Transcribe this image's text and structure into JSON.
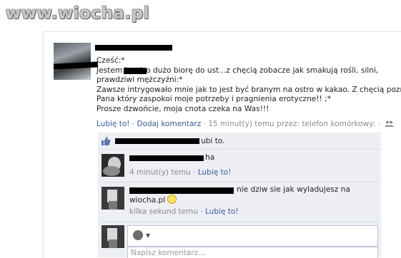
{
  "watermark": {
    "text": "www.wiocha.pl"
  },
  "post": {
    "lines": [
      "Cześć:*",
      "Jestem        bardzo dużo biorę do ust...z chęcią zobacze jak smakują rośli, silni,",
      "prawdziwi mężczyźni:*",
      "Zawsze intrygowało mnie jak to jest być branym na ostro w kakao. Z chęcią poznam",
      "Pana który zaspokoi moje potrzeby i pragnienia erotyczne!! ;*",
      "Prosze dzwońcie, moja cnota czeka na Was!!!"
    ],
    "like_link": "Lubię to!",
    "comment_link": "Dodaj komentarz",
    "timestamp": "15 minut(y) temu przez: telefon komórkowy:",
    "separator": "·"
  },
  "likes": {
    "text": "ubi to."
  },
  "comments": [
    {
      "text": "ha",
      "time": "4 minut(y) temu",
      "like_link": "Lubię to!"
    },
    {
      "text_line1": "nie dziw sie jak wyladujesz na",
      "text_line2": "wiocha.pl",
      "time": "kilka sekund temu",
      "like_link": "Lubię to!"
    }
  ],
  "composer": {
    "placeholder": "Napisz komentarz..."
  },
  "colors": {
    "link": "#3b5998",
    "meta": "#8c8c8c",
    "comment_bg": "#edeff4"
  }
}
